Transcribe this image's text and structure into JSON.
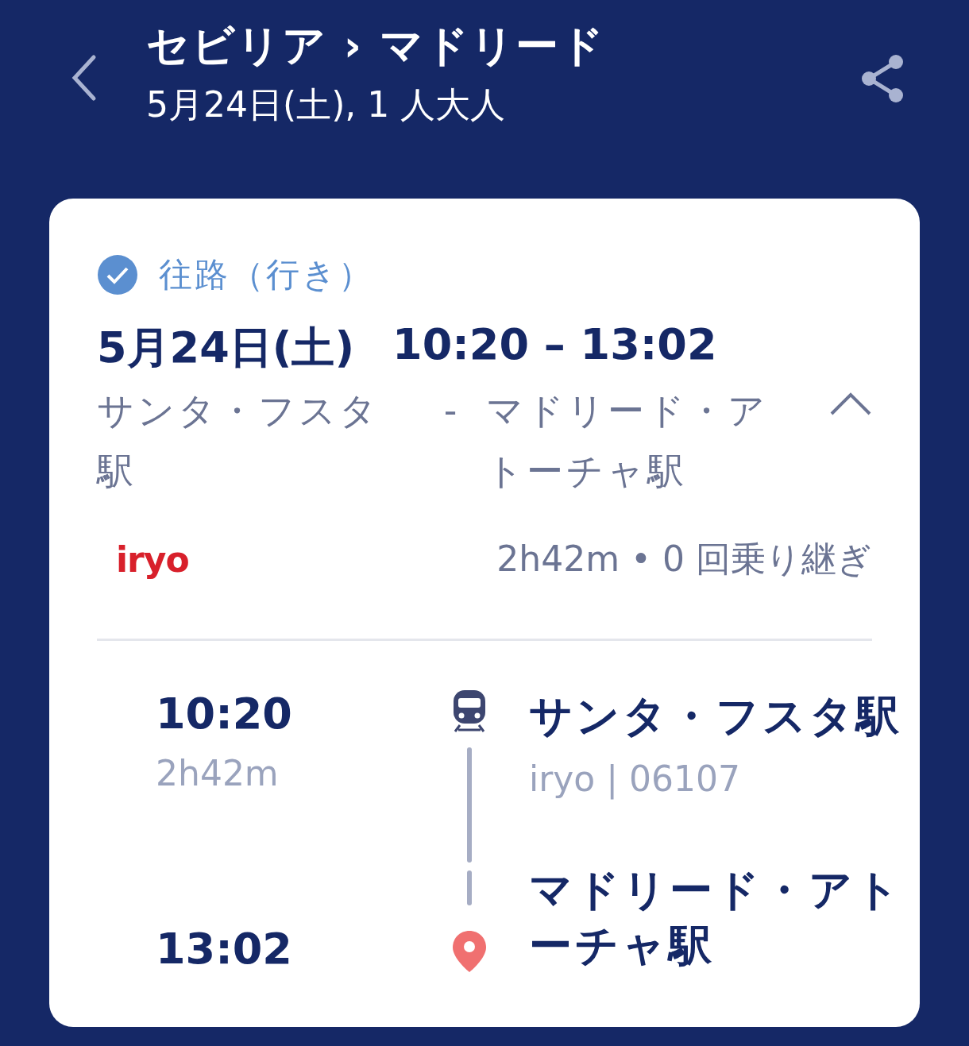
{
  "header": {
    "title": "セビリア › マドリード",
    "subtitle": "5月24日(土), 1 人大人"
  },
  "journey": {
    "checked": true,
    "direction": "往路（行き）",
    "date": "5月24日(土)",
    "time_range": "10:20 – 13:02",
    "origin": "サンタ・フスタ駅",
    "separator": "-",
    "destination": "マドリード・アトーチャ駅",
    "expanded": true,
    "operator": "iryo",
    "summary": "2h42m • 0 回乗り継ぎ"
  },
  "stops": [
    {
      "kind": "departure",
      "time": "10:20",
      "duration": "2h42m",
      "station": "サンタ・フスタ駅",
      "service": "iryo | 06107"
    },
    {
      "kind": "arrival",
      "time": "13:02",
      "station": "マドリード・アトーチャ駅"
    }
  ]
}
